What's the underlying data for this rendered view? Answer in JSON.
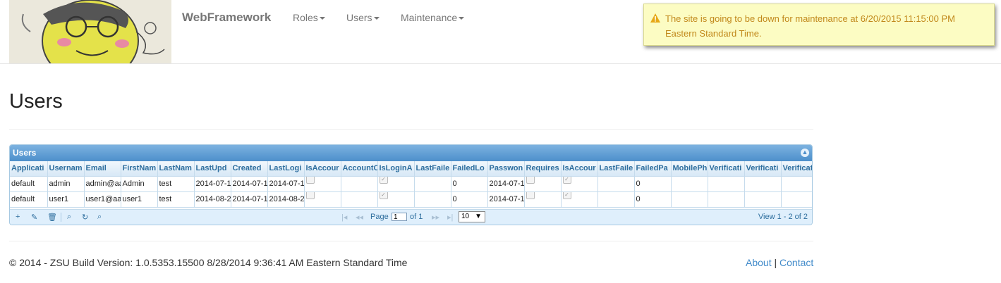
{
  "nav": {
    "brand": "WebFramework",
    "items": [
      "Roles",
      "Users",
      "Maintenance"
    ]
  },
  "notice": {
    "line1": "The site is going to be down for maintenance at 6/20/2015 11:15:00 PM",
    "line2": "Eastern Standard Time."
  },
  "page_title": "Users",
  "grid": {
    "caption": "Users",
    "columns": [
      "Applicati",
      "Usernam",
      "Email",
      "FirstNam",
      "LastNam",
      "LastUpd",
      "Created",
      "LastLogi",
      "IsAccour",
      "AccountC",
      "IsLoginA",
      "LastFaile",
      "FailedLo",
      "Passwon",
      "Requires",
      "IsAccour",
      "LastFaile",
      "FailedPa",
      "MobilePh",
      "Verificati",
      "Verificati",
      "Verificat"
    ],
    "rows": [
      [
        "default",
        "admin",
        "admin@aa",
        "Admin",
        "test",
        "2014-07-1",
        "2014-07-1",
        "2014-07-1",
        "[ ]",
        "",
        "[x]",
        "",
        "0",
        "2014-07-1",
        "[ ]",
        "[x]",
        "",
        "0",
        "",
        "",
        "",
        ""
      ],
      [
        "default",
        "user1",
        "user1@aa",
        "user1",
        "test",
        "2014-08-2",
        "2014-07-1",
        "2014-08-2",
        "[ ]",
        "",
        "[x]",
        "",
        "0",
        "2014-07-1",
        "[ ]",
        "[x]",
        "",
        "0",
        "",
        "",
        "",
        ""
      ]
    ],
    "pager": {
      "page_label": "Page",
      "page_value": "1",
      "of_label": "of 1",
      "page_size": "10",
      "view_text": "View 1 - 2 of 2"
    }
  },
  "footer": {
    "text": "© 2014 - ZSU Build Version: 1.0.5353.15500 8/28/2014 9:36:41 AM Eastern Standard Time",
    "about": "About",
    "contact": "Contact"
  },
  "colors": {
    "link": "#428bca",
    "notice_bg": "#fcfcc3",
    "notice_text": "#c1881a",
    "grid_header": "#4d8fcb"
  }
}
